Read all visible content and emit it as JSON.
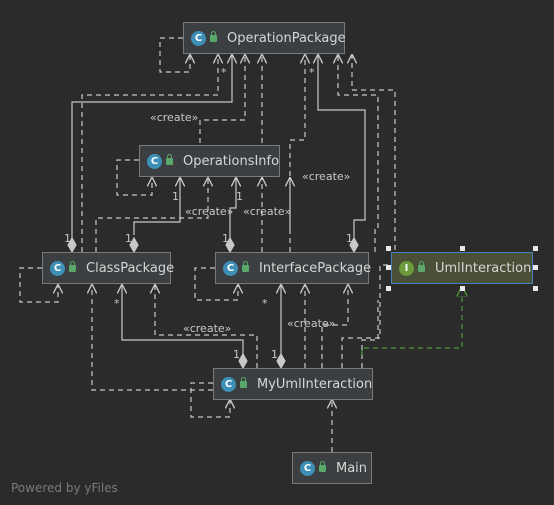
{
  "footer": "Powered by yFiles",
  "nodes": {
    "operation_package": {
      "name": "OperationPackage",
      "kind": "C"
    },
    "operations_info": {
      "name": "OperationsInfo",
      "kind": "C"
    },
    "class_package": {
      "name": "ClassPackage",
      "kind": "C"
    },
    "interface_package": {
      "name": "InterfacePackage",
      "kind": "C"
    },
    "uml_interaction": {
      "name": "UmlInteraction",
      "kind": "I"
    },
    "my_uml_interaction": {
      "name": "MyUmlInteraction",
      "kind": "C"
    },
    "main": {
      "name": "Main",
      "kind": "C"
    }
  },
  "labels": {
    "create": "«create»",
    "one": "1",
    "many": "*"
  },
  "colors": {
    "background": "#2b2b2b",
    "edge": "#c8c8c8",
    "implements_edge": "#4e9a3a"
  }
}
